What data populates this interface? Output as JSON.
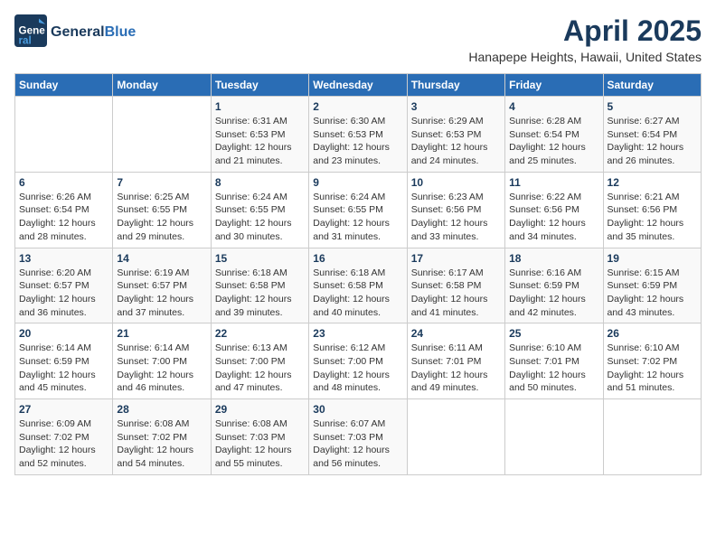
{
  "logo": {
    "general": "General",
    "blue": "Blue"
  },
  "header": {
    "month_year": "April 2025",
    "location": "Hanapepe Heights, Hawaii, United States"
  },
  "weekdays": [
    "Sunday",
    "Monday",
    "Tuesday",
    "Wednesday",
    "Thursday",
    "Friday",
    "Saturday"
  ],
  "weeks": [
    [
      {
        "day": "",
        "sunrise": "",
        "sunset": "",
        "daylight": ""
      },
      {
        "day": "",
        "sunrise": "",
        "sunset": "",
        "daylight": ""
      },
      {
        "day": "1",
        "sunrise": "Sunrise: 6:31 AM",
        "sunset": "Sunset: 6:53 PM",
        "daylight": "Daylight: 12 hours and 21 minutes."
      },
      {
        "day": "2",
        "sunrise": "Sunrise: 6:30 AM",
        "sunset": "Sunset: 6:53 PM",
        "daylight": "Daylight: 12 hours and 23 minutes."
      },
      {
        "day": "3",
        "sunrise": "Sunrise: 6:29 AM",
        "sunset": "Sunset: 6:53 PM",
        "daylight": "Daylight: 12 hours and 24 minutes."
      },
      {
        "day": "4",
        "sunrise": "Sunrise: 6:28 AM",
        "sunset": "Sunset: 6:54 PM",
        "daylight": "Daylight: 12 hours and 25 minutes."
      },
      {
        "day": "5",
        "sunrise": "Sunrise: 6:27 AM",
        "sunset": "Sunset: 6:54 PM",
        "daylight": "Daylight: 12 hours and 26 minutes."
      }
    ],
    [
      {
        "day": "6",
        "sunrise": "Sunrise: 6:26 AM",
        "sunset": "Sunset: 6:54 PM",
        "daylight": "Daylight: 12 hours and 28 minutes."
      },
      {
        "day": "7",
        "sunrise": "Sunrise: 6:25 AM",
        "sunset": "Sunset: 6:55 PM",
        "daylight": "Daylight: 12 hours and 29 minutes."
      },
      {
        "day": "8",
        "sunrise": "Sunrise: 6:24 AM",
        "sunset": "Sunset: 6:55 PM",
        "daylight": "Daylight: 12 hours and 30 minutes."
      },
      {
        "day": "9",
        "sunrise": "Sunrise: 6:24 AM",
        "sunset": "Sunset: 6:55 PM",
        "daylight": "Daylight: 12 hours and 31 minutes."
      },
      {
        "day": "10",
        "sunrise": "Sunrise: 6:23 AM",
        "sunset": "Sunset: 6:56 PM",
        "daylight": "Daylight: 12 hours and 33 minutes."
      },
      {
        "day": "11",
        "sunrise": "Sunrise: 6:22 AM",
        "sunset": "Sunset: 6:56 PM",
        "daylight": "Daylight: 12 hours and 34 minutes."
      },
      {
        "day": "12",
        "sunrise": "Sunrise: 6:21 AM",
        "sunset": "Sunset: 6:56 PM",
        "daylight": "Daylight: 12 hours and 35 minutes."
      }
    ],
    [
      {
        "day": "13",
        "sunrise": "Sunrise: 6:20 AM",
        "sunset": "Sunset: 6:57 PM",
        "daylight": "Daylight: 12 hours and 36 minutes."
      },
      {
        "day": "14",
        "sunrise": "Sunrise: 6:19 AM",
        "sunset": "Sunset: 6:57 PM",
        "daylight": "Daylight: 12 hours and 37 minutes."
      },
      {
        "day": "15",
        "sunrise": "Sunrise: 6:18 AM",
        "sunset": "Sunset: 6:58 PM",
        "daylight": "Daylight: 12 hours and 39 minutes."
      },
      {
        "day": "16",
        "sunrise": "Sunrise: 6:18 AM",
        "sunset": "Sunset: 6:58 PM",
        "daylight": "Daylight: 12 hours and 40 minutes."
      },
      {
        "day": "17",
        "sunrise": "Sunrise: 6:17 AM",
        "sunset": "Sunset: 6:58 PM",
        "daylight": "Daylight: 12 hours and 41 minutes."
      },
      {
        "day": "18",
        "sunrise": "Sunrise: 6:16 AM",
        "sunset": "Sunset: 6:59 PM",
        "daylight": "Daylight: 12 hours and 42 minutes."
      },
      {
        "day": "19",
        "sunrise": "Sunrise: 6:15 AM",
        "sunset": "Sunset: 6:59 PM",
        "daylight": "Daylight: 12 hours and 43 minutes."
      }
    ],
    [
      {
        "day": "20",
        "sunrise": "Sunrise: 6:14 AM",
        "sunset": "Sunset: 6:59 PM",
        "daylight": "Daylight: 12 hours and 45 minutes."
      },
      {
        "day": "21",
        "sunrise": "Sunrise: 6:14 AM",
        "sunset": "Sunset: 7:00 PM",
        "daylight": "Daylight: 12 hours and 46 minutes."
      },
      {
        "day": "22",
        "sunrise": "Sunrise: 6:13 AM",
        "sunset": "Sunset: 7:00 PM",
        "daylight": "Daylight: 12 hours and 47 minutes."
      },
      {
        "day": "23",
        "sunrise": "Sunrise: 6:12 AM",
        "sunset": "Sunset: 7:00 PM",
        "daylight": "Daylight: 12 hours and 48 minutes."
      },
      {
        "day": "24",
        "sunrise": "Sunrise: 6:11 AM",
        "sunset": "Sunset: 7:01 PM",
        "daylight": "Daylight: 12 hours and 49 minutes."
      },
      {
        "day": "25",
        "sunrise": "Sunrise: 6:10 AM",
        "sunset": "Sunset: 7:01 PM",
        "daylight": "Daylight: 12 hours and 50 minutes."
      },
      {
        "day": "26",
        "sunrise": "Sunrise: 6:10 AM",
        "sunset": "Sunset: 7:02 PM",
        "daylight": "Daylight: 12 hours and 51 minutes."
      }
    ],
    [
      {
        "day": "27",
        "sunrise": "Sunrise: 6:09 AM",
        "sunset": "Sunset: 7:02 PM",
        "daylight": "Daylight: 12 hours and 52 minutes."
      },
      {
        "day": "28",
        "sunrise": "Sunrise: 6:08 AM",
        "sunset": "Sunset: 7:02 PM",
        "daylight": "Daylight: 12 hours and 54 minutes."
      },
      {
        "day": "29",
        "sunrise": "Sunrise: 6:08 AM",
        "sunset": "Sunset: 7:03 PM",
        "daylight": "Daylight: 12 hours and 55 minutes."
      },
      {
        "day": "30",
        "sunrise": "Sunrise: 6:07 AM",
        "sunset": "Sunset: 7:03 PM",
        "daylight": "Daylight: 12 hours and 56 minutes."
      },
      {
        "day": "",
        "sunrise": "",
        "sunset": "",
        "daylight": ""
      },
      {
        "day": "",
        "sunrise": "",
        "sunset": "",
        "daylight": ""
      },
      {
        "day": "",
        "sunrise": "",
        "sunset": "",
        "daylight": ""
      }
    ]
  ]
}
